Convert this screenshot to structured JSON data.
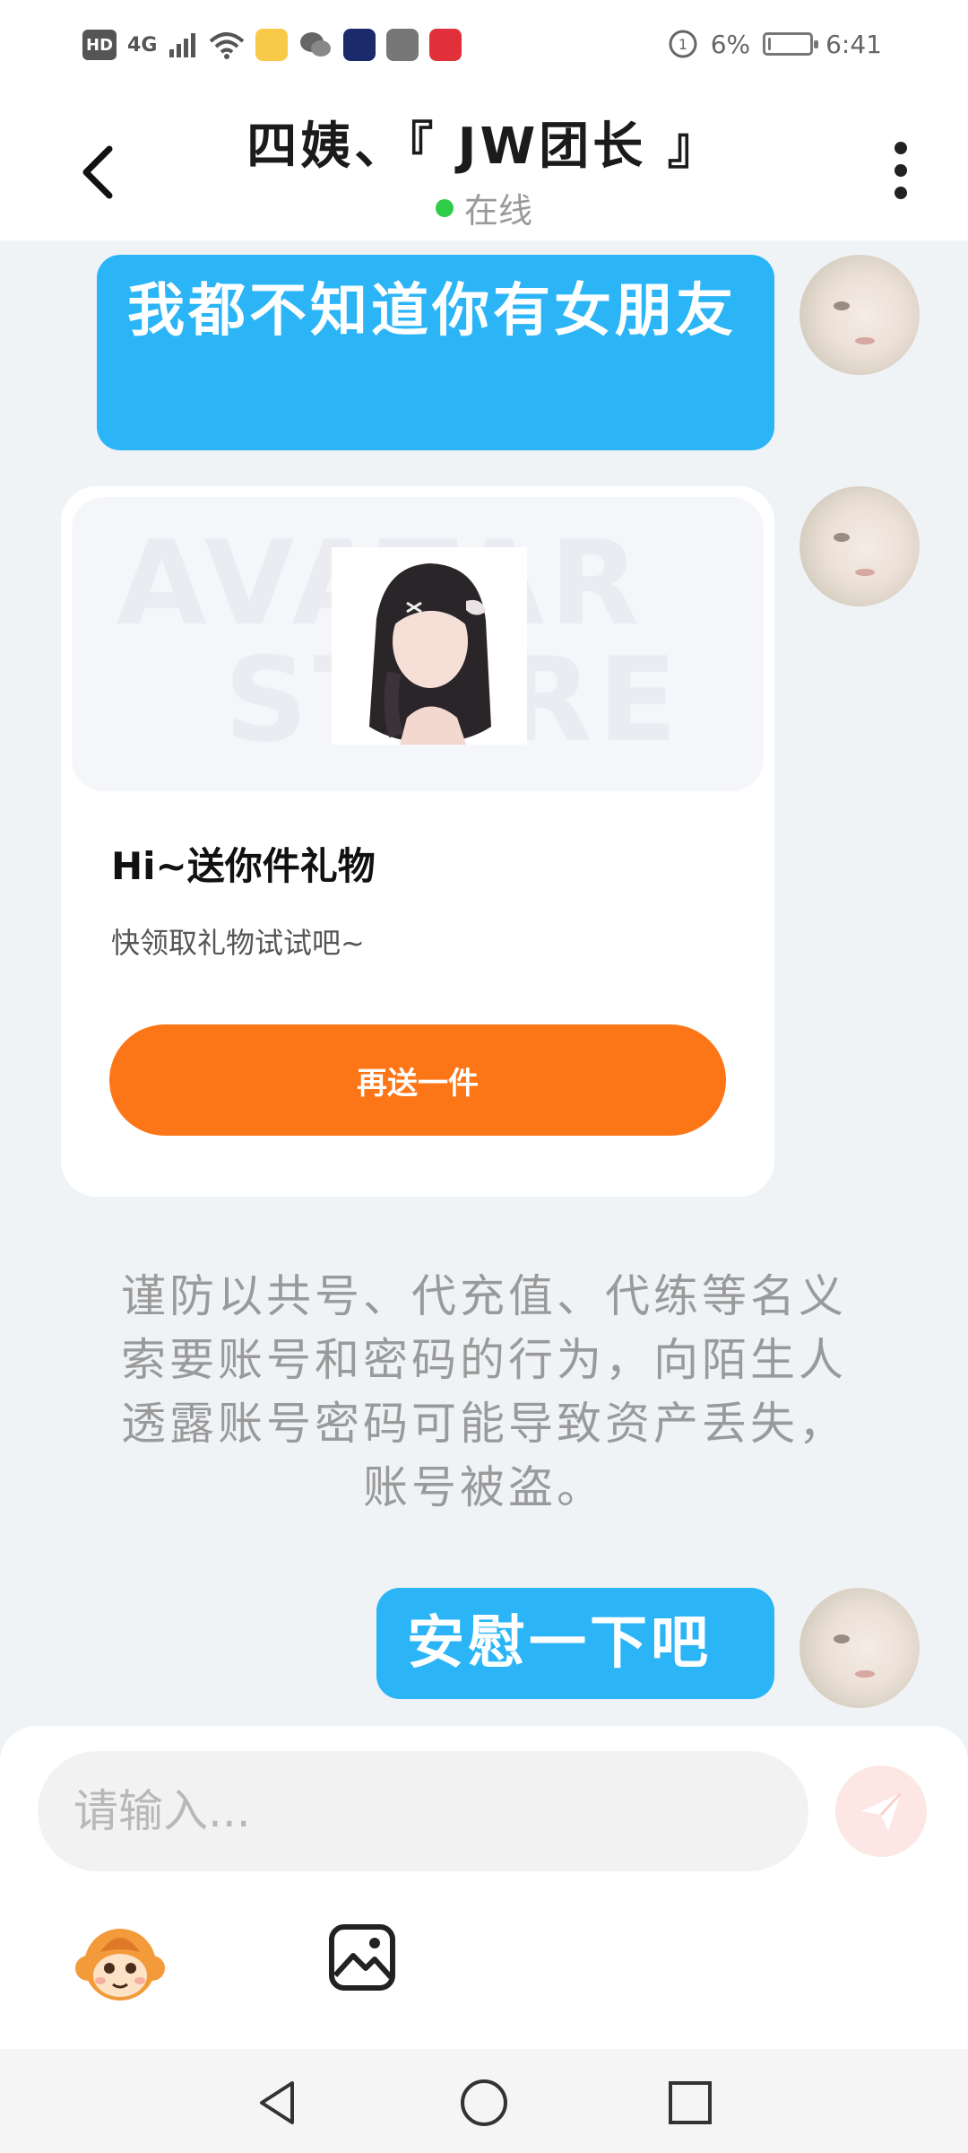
{
  "status_bar": {
    "hd_label": "HD",
    "network_label": "4G",
    "battery_text": "6%",
    "battery_level": 0.06,
    "time": "6:41"
  },
  "header": {
    "title": "四姨、『 JW团长 』",
    "status": "在线",
    "status_color": "#2ecc48"
  },
  "messages": [
    {
      "type": "text",
      "text": "我都不知道你有女朋友"
    },
    {
      "type": "gift",
      "watermark_line1": "AVATAR",
      "watermark_line2": "STORE",
      "title": "Hi~送你件礼物",
      "description": "快领取礼物试试吧~",
      "button_label": "再送一件"
    },
    {
      "type": "system",
      "text": "谨防以共号、代充值、代练等名义索要账号和密码的行为，向陌生人透露账号密码可能导致资产丢失，账号被盗。"
    },
    {
      "type": "text",
      "text": "安慰一下吧"
    }
  ],
  "input": {
    "placeholder": "请输入..."
  },
  "icons": {
    "back": "chevron-left-icon",
    "more": "more-vertical-icon",
    "send": "paper-plane-icon",
    "emoji": "monkey-emoji-icon",
    "image": "image-icon"
  },
  "colors": {
    "bubble": "#2bb5f6",
    "gift_button": "#fc7516",
    "background": "#f0f3f6",
    "send_button": "#fde7e5"
  }
}
